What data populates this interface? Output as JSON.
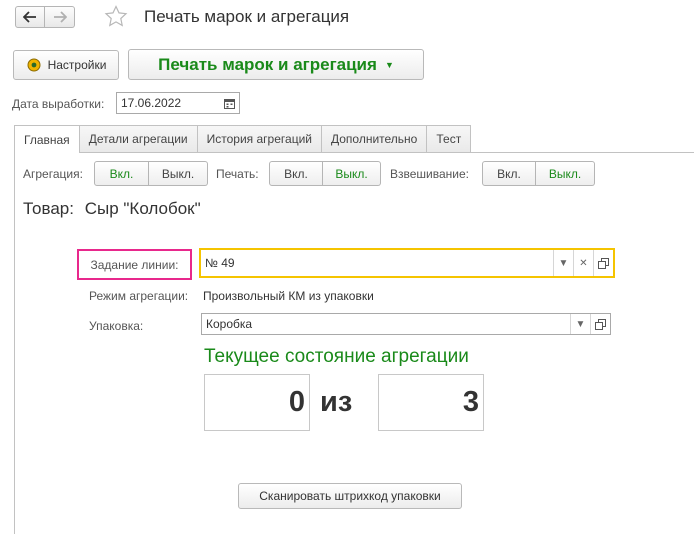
{
  "window": {
    "title": "Печать марок и агрегация"
  },
  "icons": {
    "back": "arrow-left-icon",
    "forward": "arrow-right-icon",
    "favorite": "star-icon",
    "settings": "gear-icon",
    "calendar": "calendar-icon",
    "dropdown": "chevron-down-icon",
    "clear": "close-icon",
    "open": "open-window-icon"
  },
  "toolbar": {
    "settings_label": "Настройки",
    "main_command_label": "Печать марок и агрегация"
  },
  "date": {
    "label": "Дата выработки:",
    "value": "17.06.2022"
  },
  "tabs": [
    {
      "label": "Главная",
      "active": true
    },
    {
      "label": "Детали агрегации",
      "active": false
    },
    {
      "label": "История агрегаций",
      "active": false
    },
    {
      "label": "Дополнительно",
      "active": false
    },
    {
      "label": "Тест",
      "active": false
    }
  ],
  "toggles": {
    "aggregation": {
      "label": "Агрегация:",
      "on": "Вкл.",
      "off": "Выкл.",
      "selected": "on"
    },
    "print": {
      "label": "Печать:",
      "on": "Вкл.",
      "off": "Выкл.",
      "selected": "off"
    },
    "weighing": {
      "label": "Взвешивание:",
      "on": "Вкл.",
      "off": "Выкл.",
      "selected": "off"
    }
  },
  "product": {
    "label": "Товар:",
    "value": "Сыр \"Колобок\""
  },
  "task": {
    "label": "Задание линии:",
    "value": "№ 49"
  },
  "mode": {
    "label": "Режим агрегации:",
    "value": "Произвольный КМ из упаковки"
  },
  "package": {
    "label": "Упаковка:",
    "value": "Коробка"
  },
  "state": {
    "title": "Текущее состояние агрегации",
    "current": "0",
    "of": "из",
    "total": "3"
  },
  "scan_button_label": "Сканировать штрихкод упаковки",
  "colors": {
    "accent_green": "#1a8a1a",
    "highlight_pink": "#e8288c",
    "active_field_yellow": "#f5c400"
  }
}
